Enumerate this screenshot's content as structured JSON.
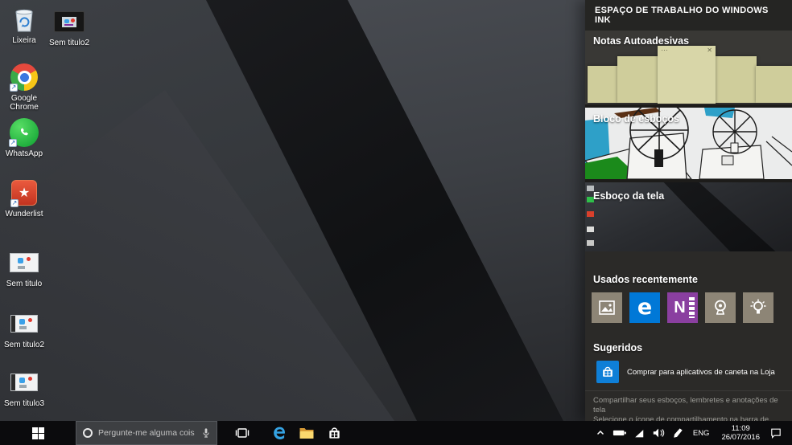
{
  "desktop": {
    "icons": [
      {
        "label": "Lixeira",
        "kind": "recycle-bin"
      },
      {
        "label": "Sem titulo2",
        "kind": "media-file"
      },
      {
        "label": "Google Chrome",
        "kind": "chrome-shortcut"
      },
      {
        "label": "WhatsApp",
        "kind": "whatsapp-shortcut"
      },
      {
        "label": "Wunderlist",
        "kind": "wunderlist-shortcut"
      },
      {
        "label": "Sem titulo",
        "kind": "image-file"
      },
      {
        "label": "Sem titulo2",
        "kind": "image-file"
      },
      {
        "label": "Sem titulo3",
        "kind": "image-file"
      }
    ]
  },
  "ink_panel": {
    "title": "ESPAÇO DE TRABALHO DO WINDOWS INK",
    "sticky_notes_label": "Notas Autoadesivas",
    "sketchpad_label": "Bloco de esboços",
    "screen_sketch_label": "Esboço da tela",
    "recent_label": "Usados recentemente",
    "recent_apps": [
      "photos",
      "edge",
      "onenote",
      "camera",
      "tips"
    ],
    "suggested_label": "Sugeridos",
    "suggested_item": "Comprar para aplicativos de caneta na Loja",
    "footer_line1": "Compartilhar seus esboços, lembretes e anotações de tela",
    "footer_line2": "Selecione o ícone de compartilhamento na barra de ferramentas.",
    "colors": {
      "accent_blue": "#0078d7",
      "onenote_purple": "#8a3fa0",
      "tile_taupe": "#8d8576",
      "sticky_note": "#d2d09e"
    }
  },
  "taskbar": {
    "search_placeholder": "Pergunte-me alguma coisa",
    "tray": {
      "language": "ENG",
      "time": "11:09",
      "date": "26/07/2016"
    }
  }
}
